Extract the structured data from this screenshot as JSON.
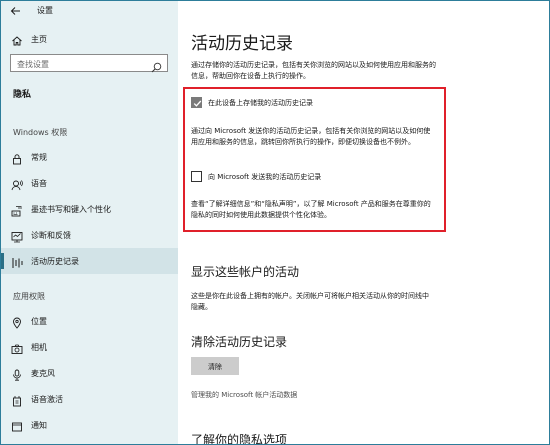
{
  "window": {
    "title": "设置"
  },
  "sidebar": {
    "home_label": "主页",
    "search_placeholder": "查找设置",
    "category": "隐私",
    "windows_section": "Windows 权限",
    "windows_items": [
      {
        "label": "常规",
        "icon": "lock-icon"
      },
      {
        "label": "语音",
        "icon": "speech-icon"
      },
      {
        "label": "墨迹书写和键入个性化",
        "icon": "pen-keyboard-icon"
      },
      {
        "label": "诊断和反馈",
        "icon": "diagnostics-icon"
      },
      {
        "label": "活动历史记录",
        "icon": "activity-history-icon",
        "selected": true
      }
    ],
    "app_section": "应用权限",
    "app_items": [
      {
        "label": "位置",
        "icon": "location-icon"
      },
      {
        "label": "相机",
        "icon": "camera-icon"
      },
      {
        "label": "麦克风",
        "icon": "microphone-icon"
      },
      {
        "label": "语音激活",
        "icon": "voice-activation-icon"
      },
      {
        "label": "通知",
        "icon": "notification-icon"
      }
    ]
  },
  "main": {
    "title": "活动历史记录",
    "intro": "通过存储你的活动历史记录，包括有关你浏览的网站以及如何使用应用和服务的信息，帮助回你在设备上执行的操作。",
    "store_checkbox": {
      "label": "在此设备上存储我的活动历史记录",
      "checked": true
    },
    "store_desc": "通过向 Microsoft 发送你的活动历史记录，包括有关你浏览的网站以及如何使用应用和服务的信息，跳转回你所执行的操作，即便切换设备也不例外。",
    "send_checkbox": {
      "label": "向 Microsoft 发送我的活动历史记录",
      "checked": false
    },
    "send_desc": "查看“了解详细信息”和“隐私声明”，以了解 Microsoft 产品和服务在尊重你的隐私的同时如何使用此数据提供个性化体验。",
    "accounts_heading": "显示这些帐户的活动",
    "accounts_desc": "这些是你在此设备上拥有的帐户。关闭帐户可将帐户相关活动从你的时间线中隐藏。",
    "clear_heading": "清除活动历史记录",
    "clear_button": "清除",
    "manage_link": "管理我的 Microsoft 帐户活动数据",
    "learn_heading": "了解你的隐私选项"
  }
}
